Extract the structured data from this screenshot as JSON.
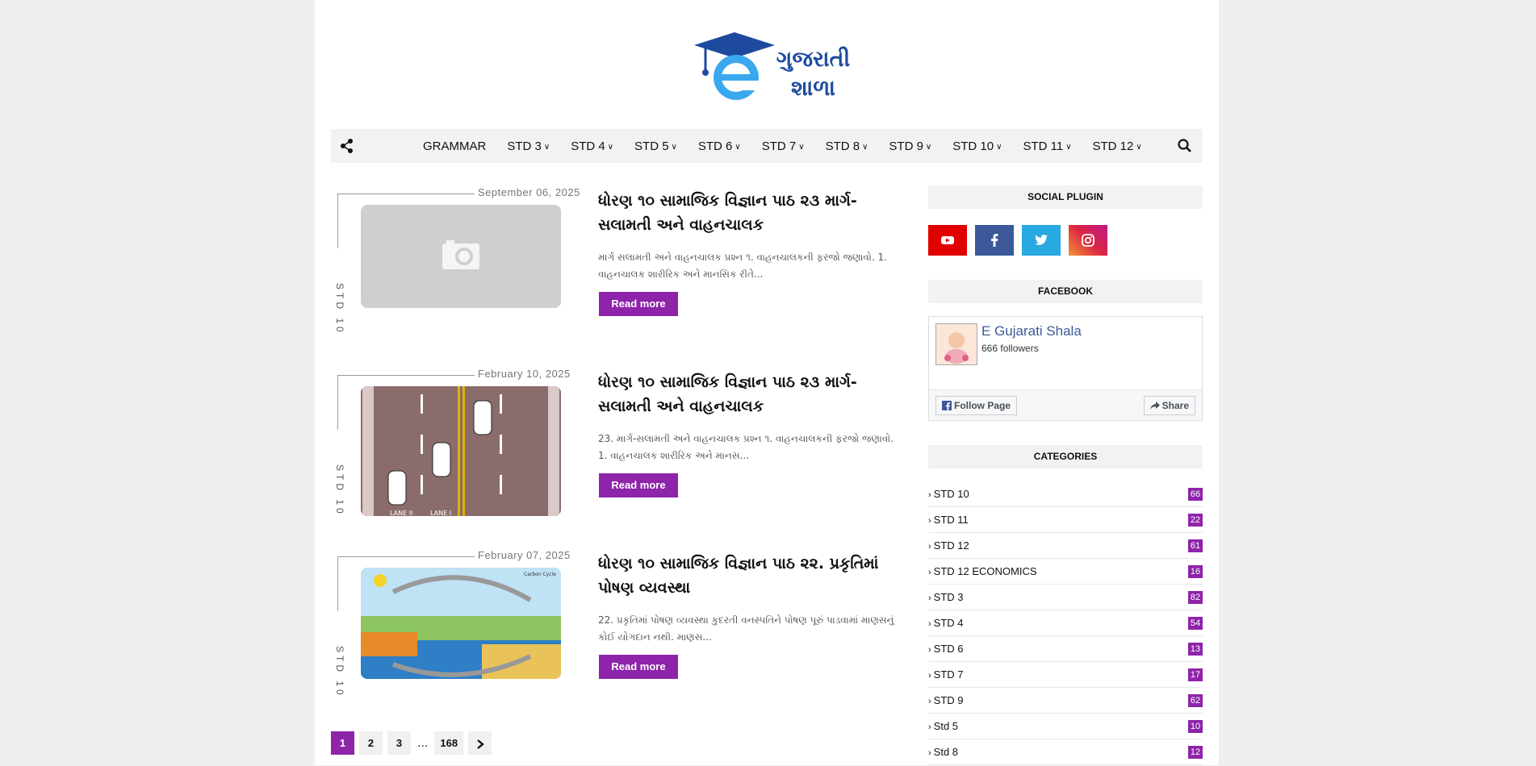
{
  "logo": {
    "text_line1": "ગુજરાતી",
    "text_line2": "શાળા"
  },
  "nav": {
    "items": [
      {
        "label": "GRAMMAR",
        "dropdown": false
      },
      {
        "label": "STD 3",
        "dropdown": true
      },
      {
        "label": "STD 4",
        "dropdown": true
      },
      {
        "label": "STD 5",
        "dropdown": true
      },
      {
        "label": "STD 6",
        "dropdown": true
      },
      {
        "label": "STD 7",
        "dropdown": true
      },
      {
        "label": "STD 8",
        "dropdown": true
      },
      {
        "label": "STD 9",
        "dropdown": true
      },
      {
        "label": "STD 10",
        "dropdown": true
      },
      {
        "label": "STD 11",
        "dropdown": true
      },
      {
        "label": "STD 12",
        "dropdown": true
      }
    ],
    "caret": "∨"
  },
  "posts": [
    {
      "date": "September 06, 2025",
      "label": "STD 10",
      "title": "ધોરણ ૧૦ સામાજિક વિજ્ઞાન પાઠ ૨૩ માર્ગ-સલામતી અને વાહનચાલક",
      "snippet": "માર્ગ સલામતી અને વાહનચાલક પ્રશ્ન ૧.  વાહનચાલકની    ફરજો જણાવો. 1. વાહનચાલક શારીરિક અને માનસિક રીતે...",
      "read_more": "Read more"
    },
    {
      "date": "February 10, 2025",
      "label": "STD 10",
      "title": "ધોરણ ૧૦ સામાજિક વિજ્ઞાન પાઠ ૨૩ માર્ગ-સલામતી અને વાહનચાલક",
      "snippet": "23. માર્ગ-સલામતી અને વાહનચાલક પ્રશ્ન ૧. વાહનચાલકની   ફરજો જણાવો. 1. વાહનચાલક શારીરિક અને માનસ...",
      "read_more": "Read more",
      "image_lane_labels": [
        "LANE II",
        "LANE I"
      ]
    },
    {
      "date": "February 07, 2025",
      "label": "STD 10",
      "title": "ધોરણ ૧૦ સામાજિક વિજ્ઞાન પાઠ ૨૨. પ્રકૃતિમાં પોષણ વ્યવસ્થા",
      "snippet": "22. પ્રકૃતિમાં પોષણ વ્યવસ્થા કુદરતી વનસ્પતિને પોષણ પૂરું પાડવામાં માણસનું કોઈ યોગદાન નથી. માણસ...",
      "read_more": "Read more",
      "image_caption": "Carbon Cycle"
    }
  ],
  "pagination": {
    "pages": [
      "1",
      "2",
      "3"
    ],
    "dots": "...",
    "last": "168",
    "current": "1"
  },
  "sidebar": {
    "social_title": "SOCIAL PLUGIN",
    "social": [
      {
        "name": "youtube",
        "color": "#e00000"
      },
      {
        "name": "facebook",
        "color": "#3b5998"
      },
      {
        "name": "twitter",
        "color": "#29a9e1"
      },
      {
        "name": "instagram",
        "color": "#c13584"
      }
    ],
    "facebook_title": "FACEBOOK",
    "fb_page_name": "E Gujarati Shala",
    "fb_followers": "666 followers",
    "fb_follow": "Follow Page",
    "fb_share": "Share",
    "categories_title": "CATEGORIES",
    "categories": [
      {
        "name": "STD 10",
        "count": "66"
      },
      {
        "name": "STD 11",
        "count": "22"
      },
      {
        "name": "STD 12",
        "count": "61"
      },
      {
        "name": "STD 12 ECONOMICS",
        "count": "16"
      },
      {
        "name": "STD 3",
        "count": "82"
      },
      {
        "name": "STD 4",
        "count": "54"
      },
      {
        "name": "STD 6",
        "count": "13"
      },
      {
        "name": "STD 7",
        "count": "17"
      },
      {
        "name": "STD 9",
        "count": "62"
      },
      {
        "name": "Std 5",
        "count": "10"
      },
      {
        "name": "Std 8",
        "count": "12"
      }
    ]
  },
  "colors": {
    "accent": "#8e24aa",
    "nav_bg": "#f2f2f2",
    "page_bg": "#efefef"
  }
}
